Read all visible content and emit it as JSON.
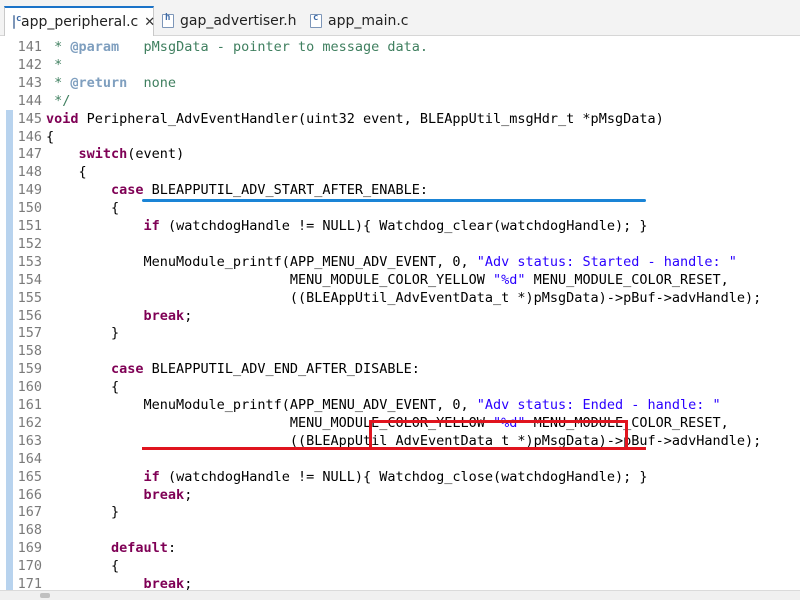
{
  "tabs": [
    {
      "label": "app_peripheral.c",
      "icon": "c-file-icon",
      "close": "✕",
      "active": true
    },
    {
      "label": "gap_advertiser.h",
      "icon": "h-file-icon",
      "active": false
    },
    {
      "label": "app_main.c",
      "icon": "c-file-icon",
      "active": false
    }
  ],
  "lines": [
    {
      "n": "141",
      "code": " * @param   pMsgData - pointer to message data."
    },
    {
      "n": "142",
      "code": " *"
    },
    {
      "n": "143",
      "code": " * @return  none"
    },
    {
      "n": "144",
      "code": " */"
    },
    {
      "n": "145",
      "code": "void Peripheral_AdvEventHandler(uint32 event, BLEAppUtil_msgHdr_t *pMsgData)"
    },
    {
      "n": "146",
      "code": "{"
    },
    {
      "n": "147",
      "code": "    switch(event)"
    },
    {
      "n": "148",
      "code": "    {"
    },
    {
      "n": "149",
      "code": "        case BLEAPPUTIL_ADV_START_AFTER_ENABLE:"
    },
    {
      "n": "150",
      "code": "        {"
    },
    {
      "n": "151",
      "code": "            if (watchdogHandle != NULL){ Watchdog_clear(watchdogHandle); }"
    },
    {
      "n": "152",
      "code": ""
    },
    {
      "n": "153",
      "code": "            MenuModule_printf(APP_MENU_ADV_EVENT, 0, \"Adv status: Started - handle: \""
    },
    {
      "n": "154",
      "code": "                              MENU_MODULE_COLOR_YELLOW \"%d\" MENU_MODULE_COLOR_RESET,"
    },
    {
      "n": "155",
      "code": "                              ((BLEAppUtil_AdvEventData_t *)pMsgData)->pBuf->advHandle);"
    },
    {
      "n": "156",
      "code": "            break;"
    },
    {
      "n": "157",
      "code": "        }"
    },
    {
      "n": "158",
      "code": ""
    },
    {
      "n": "159",
      "code": "        case BLEAPPUTIL_ADV_END_AFTER_DISABLE:"
    },
    {
      "n": "160",
      "code": "        {"
    },
    {
      "n": "161",
      "code": "            MenuModule_printf(APP_MENU_ADV_EVENT, 0, \"Adv status: Ended - handle: \""
    },
    {
      "n": "162",
      "code": "                              MENU_MODULE_COLOR_YELLOW \"%d\" MENU_MODULE_COLOR_RESET,"
    },
    {
      "n": "163",
      "code": "                              ((BLEAppUtil_AdvEventData_t *)pMsgData)->pBuf->advHandle);"
    },
    {
      "n": "164",
      "code": ""
    },
    {
      "n": "165",
      "code": "            if (watchdogHandle != NULL){ Watchdog_close(watchdogHandle); }"
    },
    {
      "n": "166",
      "code": "            break;"
    },
    {
      "n": "167",
      "code": "        }"
    },
    {
      "n": "168",
      "code": ""
    },
    {
      "n": "169",
      "code": "        default:"
    },
    {
      "n": "170",
      "code": "        {"
    },
    {
      "n": "171",
      "code": "            break;"
    }
  ],
  "colors": {
    "keyword": "#7f0055",
    "string": "#2a00ff",
    "comment": "#3f7f5f",
    "annotation_blue": "#1a84d6",
    "annotation_red": "#e0141e",
    "active_tab_accent": "#1b73c8"
  }
}
